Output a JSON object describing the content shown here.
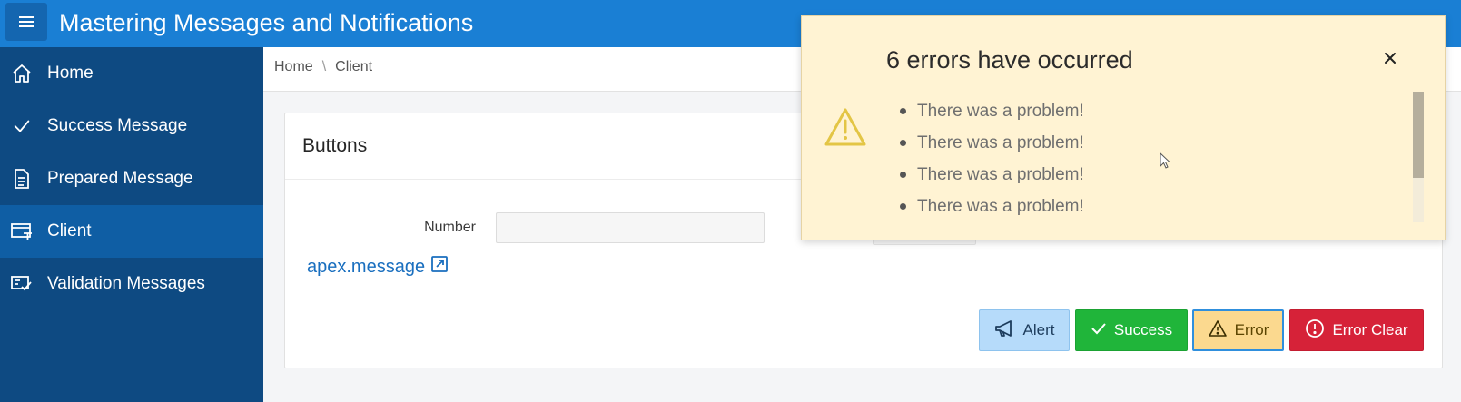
{
  "app": {
    "title": "Mastering Messages and Notifications"
  },
  "sidebar": {
    "items": [
      {
        "label": "Home",
        "icon": "home-icon",
        "active": false
      },
      {
        "label": "Success Message",
        "icon": "check-icon",
        "active": false
      },
      {
        "label": "Prepared Message",
        "icon": "document-icon",
        "active": false
      },
      {
        "label": "Client",
        "icon": "window-icon",
        "active": true
      },
      {
        "label": "Validation Messages",
        "icon": "form-check-icon",
        "active": false
      }
    ]
  },
  "breadcrumb": {
    "items": [
      "Home",
      "Client"
    ],
    "separator": "\\"
  },
  "region": {
    "title": "Buttons",
    "number_label": "Number",
    "number_value": "",
    "link_label": "apex.message"
  },
  "buttons": {
    "alert": "Alert",
    "success": "Success",
    "error": "Error",
    "error_clear": "Error Clear"
  },
  "notification": {
    "title": "6 errors have occurred",
    "errors": [
      "There was a problem!",
      "There was a problem!",
      "There was a problem!",
      "There was a problem!"
    ]
  },
  "colors": {
    "header": "#1a7fd4",
    "sidebar": "#0e4a82",
    "sidebar_active": "#0f5ea4",
    "success": "#20b53a",
    "error_bg": "#fbd98f",
    "danger": "#d62238",
    "alert": "#b6dbfa",
    "notification_bg": "#fff3d3",
    "warning_icon": "#e3c545"
  }
}
